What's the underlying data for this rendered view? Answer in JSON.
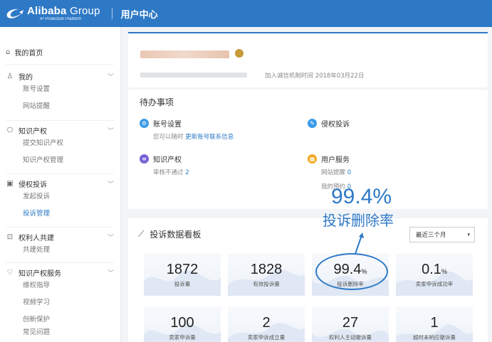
{
  "header": {
    "logo_main": "Alibaba",
    "logo_group": " Group",
    "logo_sub": "IP Protection Platform",
    "title": "用户中心"
  },
  "sidebar": {
    "home": "我的首页",
    "groups": [
      {
        "label": "我的",
        "icon": "user-icon",
        "items": [
          "账号设置",
          "网站提醒"
        ]
      },
      {
        "label": "知识产权",
        "icon": "ip-book-icon",
        "items": [
          "提交知识产权",
          "知识产权管理"
        ]
      },
      {
        "label": "侵权投诉",
        "icon": "complaint-icon",
        "items": [
          "发起投诉",
          "投诉管理"
        ],
        "active_item": 1
      },
      {
        "label": "权利人共建",
        "icon": "co-build-icon",
        "items": [
          "共建处理"
        ]
      },
      {
        "label": "知识产权服务",
        "icon": "heart-icon",
        "items": [
          "维权指导",
          "视频学习",
          "创新保护",
          "常见问题"
        ]
      }
    ]
  },
  "user_card": {
    "join_time": "加入诚信机制时间 2018年03月22日"
  },
  "todo": {
    "title": "待办事项",
    "account": {
      "label": "账号设置",
      "line_prefix": "您可以随时 ",
      "line_link": "更新账号联系信息"
    },
    "infringement": {
      "label": "侵权投诉"
    },
    "ip": {
      "label": "知识产权",
      "line_prefix": "审核不通过 ",
      "line_value": "2"
    },
    "service": {
      "label": "用户服务",
      "line1_prefix": "网站提醒 ",
      "line1_value": "0",
      "line2_prefix": "我的预约 ",
      "line2_value": "0"
    }
  },
  "stats": {
    "title": "投诉数据看板",
    "period": "最近三个月",
    "items": [
      {
        "value": "1872",
        "unit": "",
        "label": "投诉量"
      },
      {
        "value": "1828",
        "unit": "",
        "label": "有效投诉量"
      },
      {
        "value": "99.4",
        "unit": "%",
        "label": "投诉删除率"
      },
      {
        "value": "0.1",
        "unit": "%",
        "label": "卖家申诉成功率"
      },
      {
        "value": "100",
        "unit": "",
        "label": "卖家申诉量"
      },
      {
        "value": "2",
        "unit": "",
        "label": "卖家申诉成立量"
      },
      {
        "value": "27",
        "unit": "",
        "label": "权利人主动撤诉量"
      },
      {
        "value": "1",
        "unit": "",
        "label": "超时未响应撤诉量"
      }
    ]
  },
  "annotation": {
    "big": "99.4%",
    "sub": "投诉删除率"
  },
  "colors": {
    "brand": "#2e79c6",
    "account_icon": "#3a9be8",
    "infringement_icon": "#3a9be8",
    "ip_icon": "#7a62d6",
    "service_icon": "#f2a81d"
  }
}
